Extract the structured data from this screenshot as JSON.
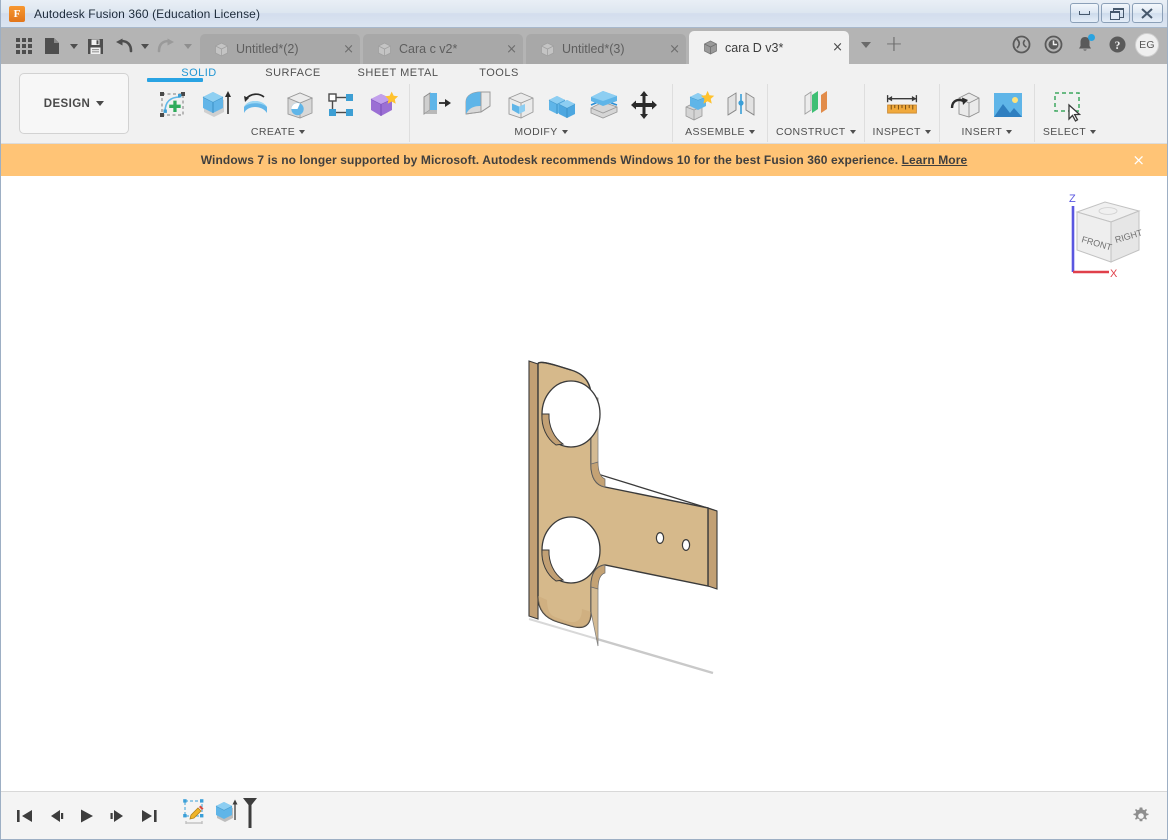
{
  "window": {
    "title": "Autodesk Fusion 360 (Education License)",
    "logo_letter": "F",
    "minimize_label": "Minimize",
    "restore_label": "Restore",
    "close_label": "Close"
  },
  "quick_access": [
    {
      "name": "app-grid",
      "label": "Show Data Panel"
    },
    {
      "name": "file-new",
      "label": "File"
    },
    {
      "name": "save",
      "label": "Save"
    },
    {
      "name": "undo",
      "label": "Undo"
    },
    {
      "name": "redo",
      "label": "Redo"
    }
  ],
  "doc_tabs": [
    {
      "label": "Untitled*(2)",
      "active": false,
      "close": "×"
    },
    {
      "label": "Cara c v2*",
      "active": false,
      "close": "×"
    },
    {
      "label": "Untitled*(3)",
      "active": false,
      "close": "×"
    },
    {
      "label": "cara D v3*",
      "active": true,
      "close": "×"
    }
  ],
  "tab_controls": {
    "overflow": "chevron-down",
    "new_tab": "+"
  },
  "header_icons": [
    {
      "name": "extensions-icon",
      "label": "Extensions"
    },
    {
      "name": "job-status-icon",
      "label": "Job Status"
    },
    {
      "name": "notifications-icon",
      "label": "Notifications"
    },
    {
      "name": "help-icon",
      "label": "Help"
    }
  ],
  "account": {
    "initials": "EG"
  },
  "workspace": {
    "label": "DESIGN"
  },
  "ribbon": {
    "tabs": [
      {
        "label": "SOLID",
        "active": true
      },
      {
        "label": "SURFACE",
        "active": false
      },
      {
        "label": "SHEET METAL",
        "active": false
      },
      {
        "label": "TOOLS",
        "active": false
      }
    ],
    "groups": [
      {
        "label": "CREATE",
        "has_dropdown": true,
        "icons": [
          "create-sketch-icon",
          "extrude-icon",
          "revolve-icon",
          "hole-icon",
          "rib-icon",
          "pattern-icon"
        ]
      },
      {
        "label": "MODIFY",
        "has_dropdown": true,
        "icons": [
          "press-pull-icon",
          "fillet-icon",
          "shell-icon",
          "combine-icon",
          "offset-face-icon",
          "move-copy-icon"
        ]
      },
      {
        "label": "ASSEMBLE",
        "has_dropdown": true,
        "icons": [
          "new-component-icon",
          "joint-icon"
        ]
      },
      {
        "label": "CONSTRUCT",
        "has_dropdown": true,
        "icons": [
          "offset-plane-icon"
        ]
      },
      {
        "label": "INSPECT",
        "has_dropdown": true,
        "icons": [
          "measure-icon"
        ]
      },
      {
        "label": "INSERT",
        "has_dropdown": true,
        "icons": [
          "insert-derive-icon",
          "insert-image-icon"
        ]
      },
      {
        "label": "SELECT",
        "has_dropdown": true,
        "icons": [
          "select-window-icon"
        ]
      }
    ]
  },
  "banner": {
    "message": "Windows 7 is no longer supported by Microsoft. Autodesk recommends Windows 10 for the best Fusion 360 experience.",
    "link": "Learn More",
    "close": "×",
    "background": "#ffc476"
  },
  "viewcube": {
    "faces": {
      "front": "FRONT",
      "right": "RIGHT"
    },
    "axes": {
      "z": "Z",
      "x": "X"
    },
    "z_color": "#5a57e0",
    "x_color": "#e0404a"
  },
  "canvas": {
    "background": "#ffffff",
    "model_name": "cara D v3",
    "model_fill": "#d6b98b",
    "model_shade": "#c9a877",
    "model_edge": "#3a3a3a"
  },
  "timeline": {
    "buttons": [
      {
        "name": "go-to-beginning",
        "label": "Go to beginning"
      },
      {
        "name": "step-backward",
        "label": "Step backward"
      },
      {
        "name": "play-playback",
        "label": "Play"
      },
      {
        "name": "step-forward",
        "label": "Step forward"
      },
      {
        "name": "go-to-end",
        "label": "Go to end"
      }
    ],
    "features": [
      {
        "name": "sketch-feature",
        "label": "Sketch1"
      },
      {
        "name": "extrude-feature",
        "label": "Extrude1"
      }
    ],
    "settings_label": "Timeline settings"
  }
}
